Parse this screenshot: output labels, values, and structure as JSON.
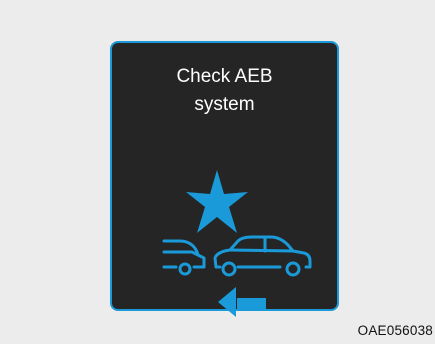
{
  "display": {
    "message_line1": "Check AEB",
    "message_line2": "system",
    "icon": "aeb-collision-warning-icon",
    "accent_color": "#1a9ad9",
    "background_color": "#252525"
  },
  "figure_code": "OAE056038"
}
